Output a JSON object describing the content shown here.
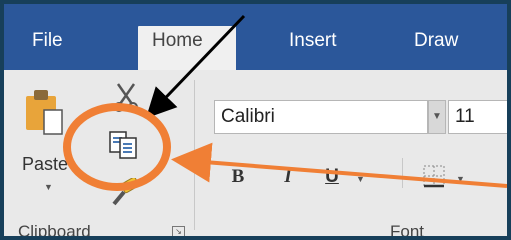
{
  "tabs": [
    {
      "label": "File",
      "active": false
    },
    {
      "label": "Home",
      "active": true
    },
    {
      "label": "Insert",
      "active": false
    },
    {
      "label": "Draw",
      "active": false
    }
  ],
  "clipboard": {
    "paste_label": "Paste",
    "group_label": "Clipboard",
    "buttons": [
      "paste-icon",
      "cut-icon",
      "copy-icon",
      "format-painter-icon"
    ]
  },
  "font": {
    "group_label": "Font",
    "font_name": "Calibri",
    "font_size": "11",
    "bold_label": "B",
    "italic_label": "I",
    "underline_label": "U"
  },
  "colors": {
    "tabbar": "#2b579a",
    "ribbon": "#e9e9e9",
    "annotation_circle": "#f07f35",
    "annotation_arrow_orange": "#f07f35",
    "annotation_arrow_black": "#000000"
  }
}
